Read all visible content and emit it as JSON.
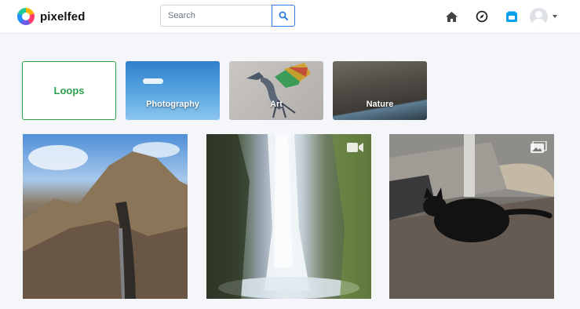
{
  "brand": {
    "name": "pixelfed"
  },
  "search": {
    "placeholder": "Search",
    "value": ""
  },
  "nav": {
    "icons": [
      "home-icon",
      "compass-icon",
      "notifications-icon"
    ],
    "active_color": "#08a0e9"
  },
  "categories": [
    {
      "label": "Loops"
    },
    {
      "label": "Photography"
    },
    {
      "label": "Art"
    },
    {
      "label": "Nature"
    }
  ],
  "posts": [
    {
      "subject": "mountain-trail",
      "type": "photo"
    },
    {
      "subject": "waterfall",
      "type": "video"
    },
    {
      "subject": "black-cat",
      "type": "album"
    }
  ],
  "colors": {
    "accent": "#2c7be5",
    "loops_green": "#2e9e4b"
  }
}
